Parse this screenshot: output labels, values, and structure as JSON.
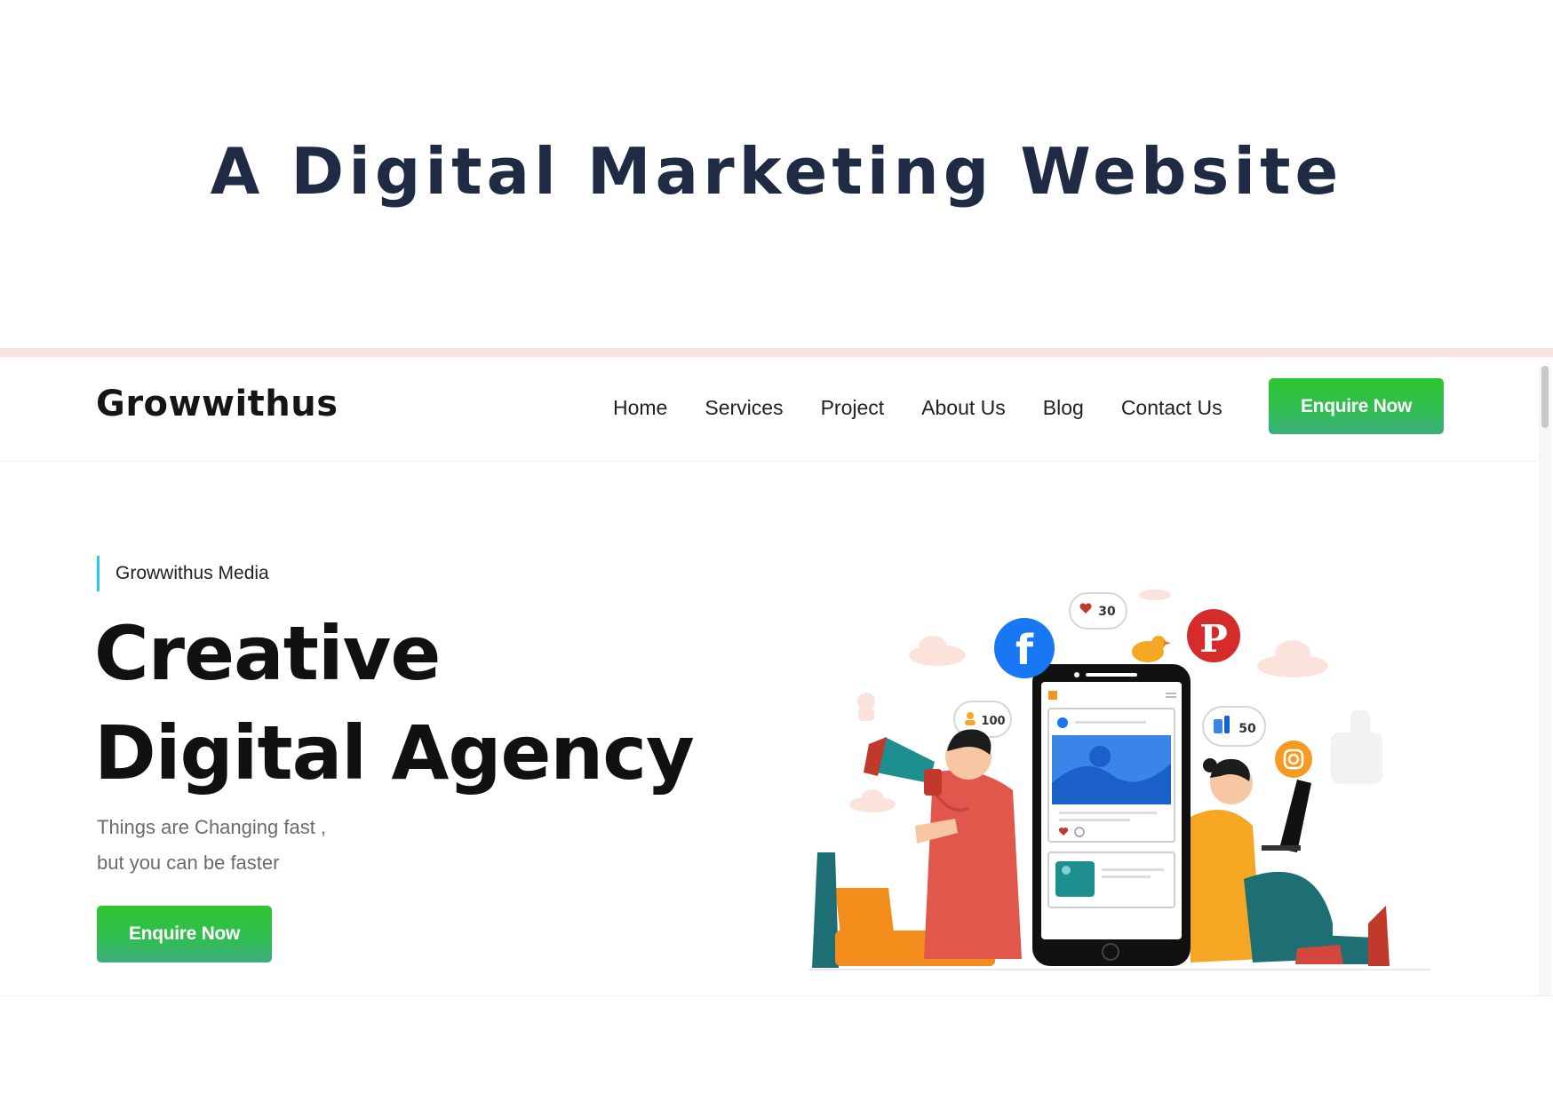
{
  "page": {
    "heading": "A Digital Marketing Website"
  },
  "navbar": {
    "brand": "Growwithus",
    "links": [
      "Home",
      "Services",
      "Project",
      "About Us",
      "Blog",
      "Contact Us"
    ],
    "cta_label": "Enquire Now"
  },
  "hero": {
    "tagline": "Growwithus Media",
    "title_line1": "Creative",
    "title_line2": "Digital Agency",
    "sub_line1": "Things are Changing fast ,",
    "sub_line2": "but you can be faster",
    "cta_label": "Enquire Now"
  },
  "illustration": {
    "bubble_likes": "30",
    "bubble_followers": "100",
    "bubble_thumbs": "50",
    "icons": [
      "facebook-icon",
      "pinterest-icon",
      "instagram-icon",
      "megaphone-icon",
      "bird-icon",
      "laptop-icon",
      "smartphone-icon"
    ]
  },
  "colors": {
    "heading": "#1f2a44",
    "accent_green": "#2ec62f",
    "tagline_bar": "#26c6ef",
    "facebook": "#1877f2",
    "pinterest": "#d62b2b",
    "instagram": "#f59b22"
  }
}
